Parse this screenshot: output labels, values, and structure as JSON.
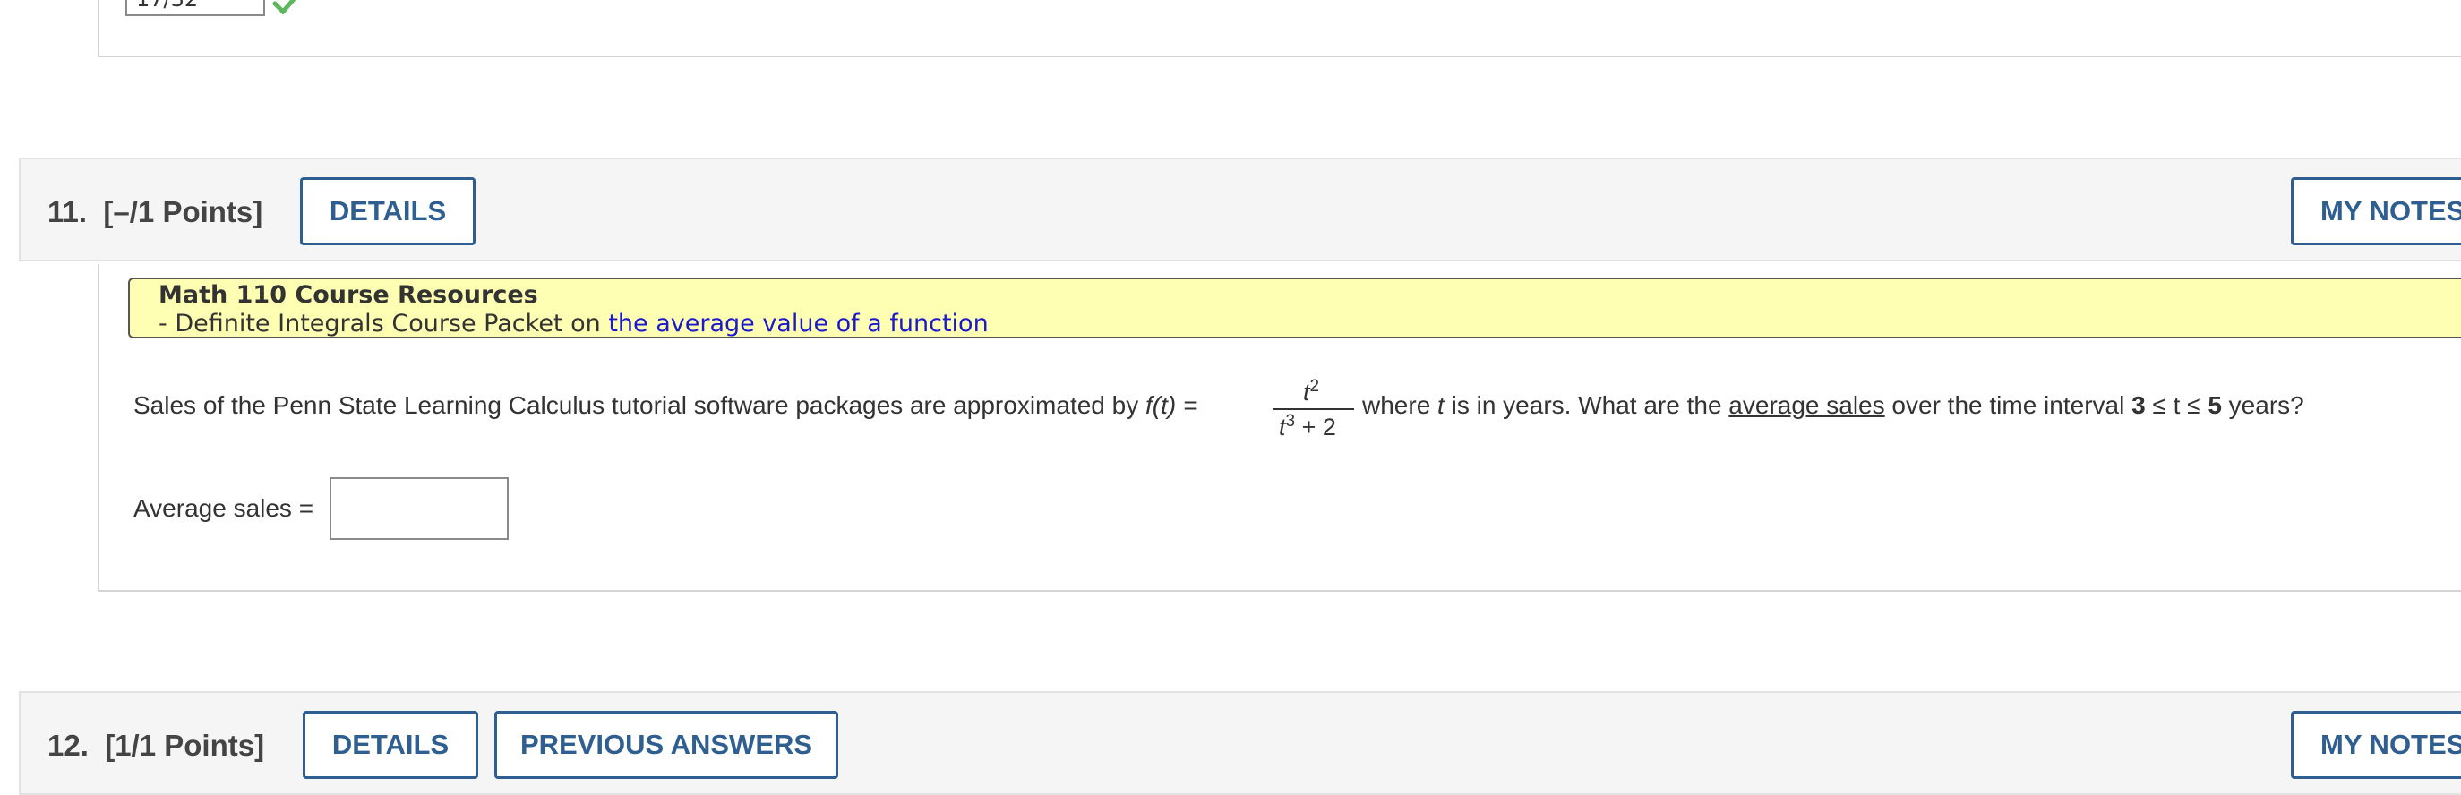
{
  "previous_question": {
    "answer_value": "17/32",
    "colors": {
      "check": "#5cb85c"
    }
  },
  "question11": {
    "number": "11.",
    "points": "[–/1 Points]",
    "details_label": "DETAILS",
    "my_notes_label": "MY NOTES",
    "resources": {
      "title": "Math 110 Course Resources",
      "line_prefix": "- Definite Integrals Course Packet on ",
      "link_text": "the average value of a function"
    },
    "problem": {
      "part1": "Sales of the Penn State Learning Calculus tutorial software packages are approximated by ",
      "func": "f(t) =",
      "numerator_base": "t",
      "numerator_exp": "2",
      "denominator_base": "t",
      "denominator_exp": "3",
      "denominator_rest": " + 2",
      "part2": " where ",
      "var": "t",
      "part3": " is in years. What are the ",
      "underlined": "average sales",
      "part4": " over the time interval ",
      "interval_lo": "3",
      "interval_mid": " ≤ t ≤ ",
      "interval_hi": "5",
      "part5": " years?"
    },
    "answer_label": "Average sales =",
    "answer_value": ""
  },
  "question12": {
    "number": "12.",
    "points": "[1/1 Points]",
    "details_label": "DETAILS",
    "previous_answers_label": "PREVIOUS ANSWERS",
    "my_notes_label": "MY NOTES"
  },
  "colors": {
    "accent": "#2f5f91",
    "header_bg": "#f5f5f5",
    "resource_bg": "#ffffb3",
    "link": "#1a1acc"
  }
}
